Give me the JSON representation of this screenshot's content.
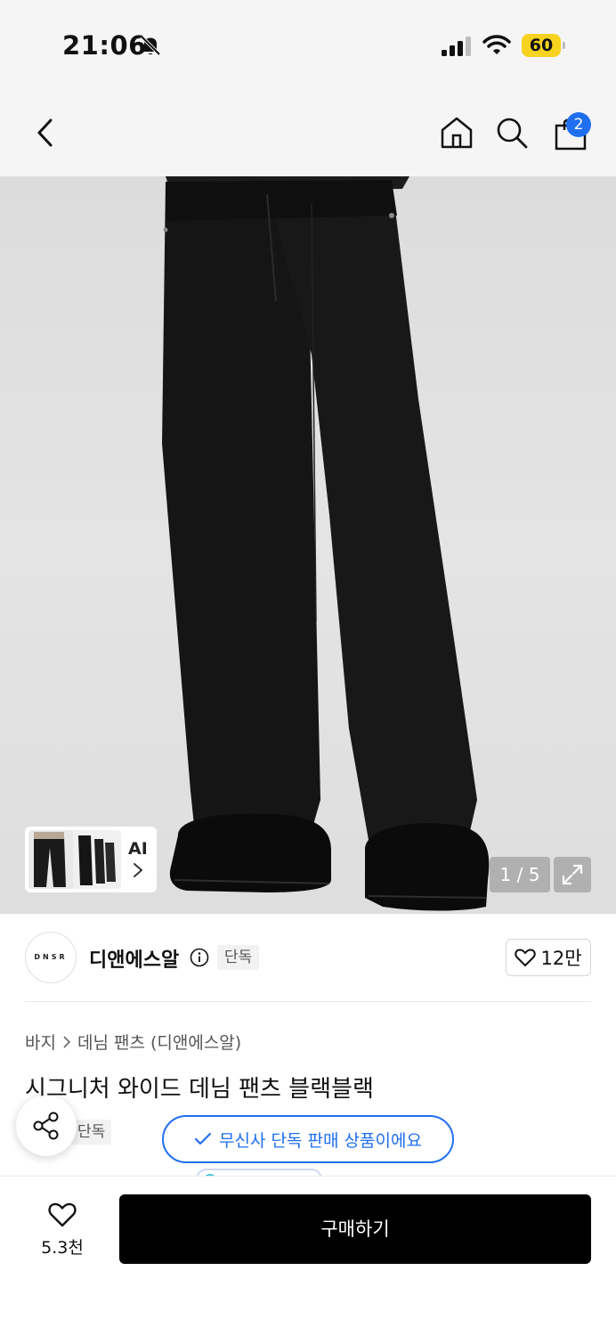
{
  "status_bar": {
    "time": "21:06",
    "battery_level": "60",
    "icons": [
      "bell-slash-icon",
      "cellular-signal-icon",
      "wifi-icon",
      "battery-icon"
    ],
    "battery_color": "#f7d21e"
  },
  "nav": {
    "icons": [
      "chevron-left-icon",
      "home-icon",
      "search-icon",
      "shopping-bag-icon"
    ],
    "cart_badge": "2",
    "badge_color": "#1f6ff0"
  },
  "gallery": {
    "ai_label": "AI",
    "page_counter": "1 / 5",
    "icons": [
      "chevron-right-icon",
      "expand-icon"
    ]
  },
  "brand": {
    "logo_text": "DNSR",
    "name": "디앤에스알",
    "tag": "단독",
    "likes": "12만",
    "icons": [
      "info-icon",
      "heart-outline-icon"
    ]
  },
  "product": {
    "breadcrumb": [
      "바지",
      "데님 팬츠 (디앤에스알)"
    ],
    "title": "시그니처 와이드 데님 팬츠 블랙블랙",
    "exclusive_tag": "단독",
    "tooltip": "무신사 단독 판매 상품이에요",
    "accent_color": "#1f6ff0",
    "icons": [
      "share-icon",
      "check-icon"
    ]
  },
  "bottom_bar": {
    "wish_count": "5.3천",
    "buy_label": "구매하기",
    "icons": [
      "heart-outline-icon"
    ]
  }
}
